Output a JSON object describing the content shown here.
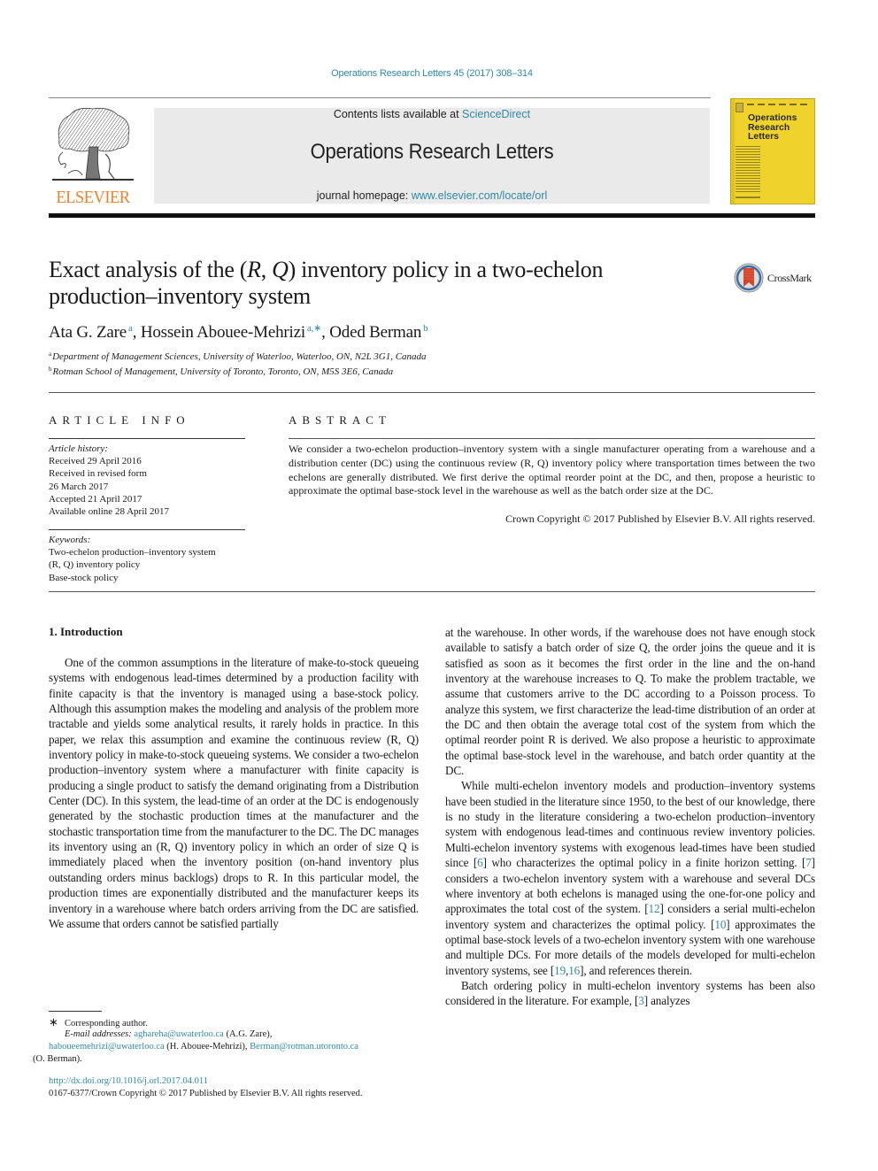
{
  "header": {
    "journal_ref": "Operations Research Letters 45 (2017) 308–314",
    "contents_prefix": "Contents lists available at ",
    "contents_link": "ScienceDirect",
    "journal_title": "Operations Research Letters",
    "homepage_prefix": "journal homepage: ",
    "homepage_link": "www.elsevier.com/locate/orl",
    "publisher_logo": "ELSEVIER",
    "cover_title_lines": [
      "Operations",
      "Research",
      "Letters"
    ],
    "colors": {
      "link": "#2e8aa8",
      "elsevier_orange": "#f0822a",
      "cover_yellow": "#f0d22c",
      "masthead_gray": "#eaeaea"
    }
  },
  "article": {
    "title_part1": "Exact analysis of the (",
    "title_R": "R",
    "title_sep": ", ",
    "title_Q": "Q",
    "title_part2": ") inventory policy in a two-echelon",
    "title_line2": "production–inventory system",
    "crossmark_label": "CrossMark",
    "authors": [
      {
        "name": "Ata G. Zare",
        "sup": "a"
      },
      {
        "name": "Hossein Abouee-Mehrizi",
        "sup": "a,∗"
      },
      {
        "name": "Oded Berman",
        "sup": "b"
      }
    ],
    "affiliations": [
      {
        "sup": "a",
        "text": "Department of Management Sciences, University of Waterloo, Waterloo, ON, N2L 3G1, Canada"
      },
      {
        "sup": "b",
        "text": "Rotman School of Management, University of Toronto, Toronto, ON, M5S 3E6, Canada"
      }
    ]
  },
  "article_info": {
    "heading": "ARTICLE INFO",
    "history_label": "Article history:",
    "history": [
      "Received 29 April 2016",
      "Received in revised form",
      "26 March 2017",
      "Accepted 21 April 2017",
      "Available online 28 April 2017"
    ],
    "keywords_label": "Keywords:",
    "keywords": [
      "Two-echelon production–inventory system",
      "(R, Q) inventory policy",
      "Base-stock policy"
    ]
  },
  "abstract": {
    "heading": "ABSTRACT",
    "text": "We consider a two-echelon production–inventory system with a single manufacturer operating from a warehouse and a distribution center (DC) using the continuous review (R, Q) inventory policy where transportation times between the two echelons are generally distributed. We first derive the optimal reorder point at the DC, and then, propose a heuristic to approximate the optimal base-stock level in the warehouse as well as the batch order size at the DC.",
    "copyright": "Crown Copyright © 2017 Published by Elsevier B.V. All rights reserved."
  },
  "body": {
    "section_heading": "1.  Introduction",
    "left_paragraph": "One of the common assumptions in the literature of make-to-stock queueing systems with endogenous lead-times determined by a production facility with finite capacity is that the inventory is managed using a base-stock policy. Although this assumption makes the modeling and analysis of the problem more tractable and yields some analytical results, it rarely holds in practice. In this paper, we relax this assumption and examine the continuous review (R, Q) inventory policy in make-to-stock queueing systems. We consider a two-echelon production–inventory system where a manufacturer with finite capacity is producing a single product to satisfy the demand originating from a Distribution Center (DC). In this system, the lead-time of an order at the DC is endogenously generated by the stochastic production times at the manufacturer and the stochastic transportation time from the manufacturer to the DC. The DC manages its inventory using an (R, Q) inventory policy in which an order of size Q is immediately placed when the inventory position (on-hand inventory plus outstanding orders minus backlogs) drops to R. In this particular model, the production times are exponentially distributed and the manufacturer keeps its inventory in a warehouse where batch orders arriving from the DC are satisfied. We assume that orders cannot be satisfied partially",
    "right_paragraph_1": "at the warehouse. In other words, if the warehouse does not have enough stock available to satisfy a batch order of size Q, the order joins the queue and it is satisfied as soon as it becomes the first order in the line and the on-hand inventory at the warehouse increases to Q. To make the problem tractable, we assume that customers arrive to the DC according to a Poisson process. To analyze this system, we first characterize the lead-time distribution of an order at the DC and then obtain the average total cost of the system from which the optimal reorder point R is derived. We also propose a heuristic to approximate the optimal base-stock level in the warehouse, and batch order quantity at the DC.",
    "right_paragraph_2": {
      "t1": "While multi-echelon inventory models and production–inventory systems have been studied in the literature since 1950, to the best of our knowledge, there is no study in the literature considering a two-echelon production–inventory system with endogenous lead-times and continuous review inventory policies. Multi-echelon inventory systems with exogenous lead-times have been studied since ",
      "ref1": "6",
      "t2": " who characterizes the optimal policy in a finite horizon setting. ",
      "ref2": "7",
      "t3": " considers a two-echelon inventory system with a warehouse and several DCs where inventory at both echelons is managed using the one-for-one policy and approximates the total cost of the system. ",
      "ref3": "12",
      "t4": " considers a serial multi-echelon inventory system and characterizes the optimal policy. ",
      "ref4": "10",
      "t5": " approximates the optimal base-stock levels of a two-echelon inventory system with one warehouse and multiple DCs. For more details of the models developed for multi-echelon inventory systems, see ",
      "ref5a": "19",
      "ref5b": "16",
      "t6": ", and references therein."
    },
    "right_paragraph_3": {
      "t1": "Batch ordering policy in multi-echelon inventory systems has been also considered in the literature. For example, ",
      "ref1": "3",
      "t2": " analyzes"
    }
  },
  "footnotes": {
    "star": "∗",
    "corresponding": "Corresponding author.",
    "email_label": "E-mail addresses:",
    "emails": [
      {
        "address": "aghareha@uwaterloo.ca",
        "name": "(A.G. Zare),"
      },
      {
        "address": "haboueemehrizi@uwaterloo.ca",
        "name": "(H. Abouee-Mehrizi),"
      },
      {
        "address": "Berman@rotman.utoronto.ca",
        "name": "(O. Berman)."
      }
    ],
    "doi": "http://dx.doi.org/10.1016/j.orl.2017.04.011",
    "issn_copyright": "0167-6377/Crown Copyright © 2017 Published by Elsevier B.V. All rights reserved."
  }
}
